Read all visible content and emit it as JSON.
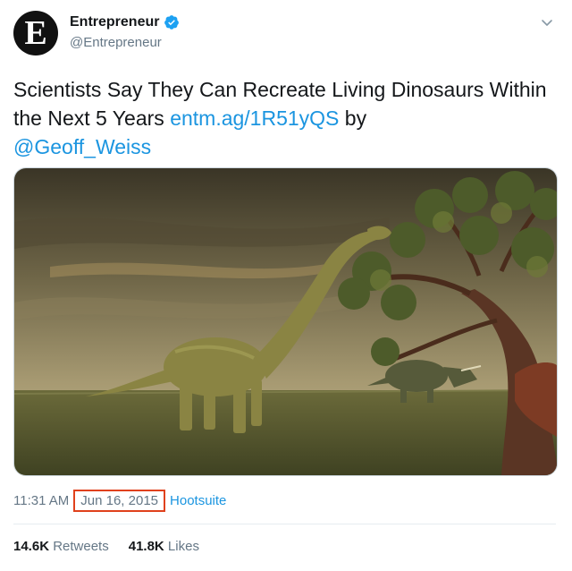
{
  "author": {
    "avatar_letter": "E",
    "display_name": "Entrepreneur",
    "handle": "@Entrepreneur",
    "verified": true
  },
  "tweet": {
    "text_main": "Scientists Say They Can Recreate Living Dinosaurs Within the Next 5 Years ",
    "link": "entm.ag/1R51yQS",
    "by_text": " by",
    "mention": "@Geoff_Weiss"
  },
  "meta": {
    "time": "11:31 AM",
    "separator": "·",
    "date": "Jun 16, 2015",
    "source": "Hootsuite"
  },
  "stats": {
    "retweets_count": "14.6K",
    "retweets_label": " Retweets",
    "likes_count": "41.8K",
    "likes_label": " Likes"
  },
  "colors": {
    "link": "#1b95e0",
    "secondary_text": "#657786",
    "highlight_box": "#e0411c",
    "verified": "#1da1f2"
  },
  "icons": {
    "verified": "verified-badge-icon",
    "menu": "chevron-down-icon"
  }
}
